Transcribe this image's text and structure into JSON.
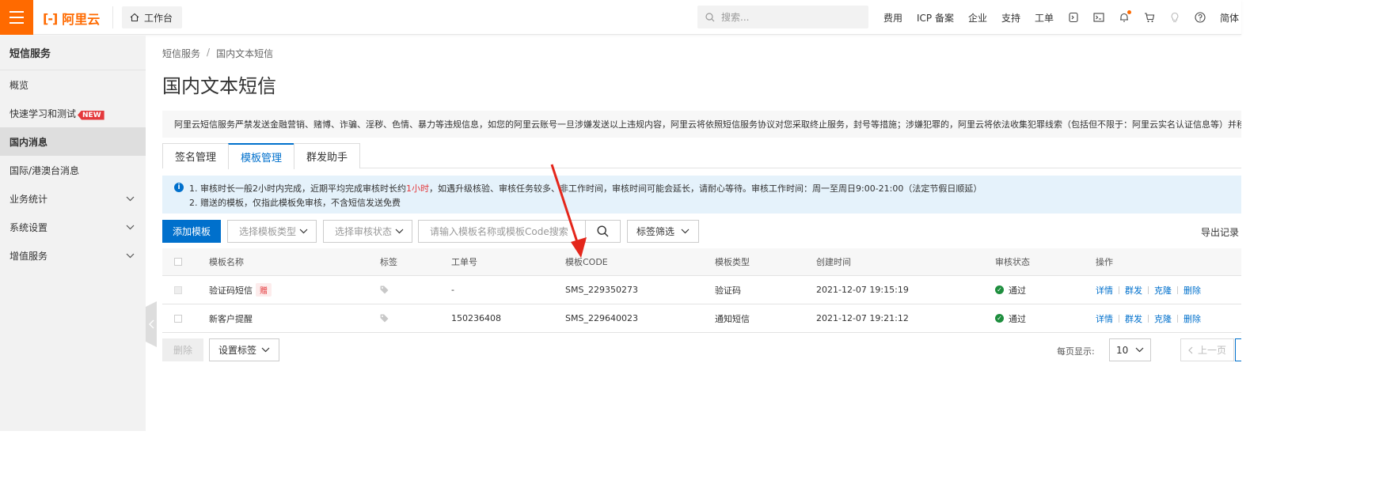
{
  "topbar": {
    "logo_text": "阿里云",
    "logo_mark": "[-]",
    "workbench": "工作台",
    "search_placeholder": "搜索...",
    "nav": [
      "费用",
      "ICP 备案",
      "企业",
      "支持",
      "工单"
    ],
    "language": "简体"
  },
  "sidebar": {
    "title": "短信服务",
    "items": [
      {
        "label": "概览"
      },
      {
        "label": "快速学习和测试",
        "badge": "NEW"
      },
      {
        "label": "国内消息",
        "active": true
      },
      {
        "label": "国际/港澳台消息"
      },
      {
        "label": "业务统计",
        "expandable": true
      },
      {
        "label": "系统设置",
        "expandable": true
      },
      {
        "label": "增值服务",
        "expandable": true
      }
    ]
  },
  "breadcrumb": [
    "短信服务",
    "国内文本短信"
  ],
  "breadcrumb_sep": "/",
  "page_title": "国内文本短信",
  "notice": "阿里云短信服务严禁发送金融营销、赌博、诈骗、淫秽、色情、暴力等违规信息，如您的阿里云账号一旦涉嫌发送以上违规内容，阿里云将依照短信服务协议对您采取终止服务，封号等措施；涉嫌犯罪的，阿里云将依法收集犯罪线索（包括但不限于：阿里云实名认证信息等）并移交公",
  "tabs": [
    {
      "label": "签名管理"
    },
    {
      "label": "模板管理",
      "active": true
    },
    {
      "label": "群发助手"
    }
  ],
  "info": {
    "icon": "i",
    "line1_prefix": "1. 审核时长一般2小时内完成，近期平均完成审核时长约",
    "line1_highlight": "1小时",
    "line1_suffix": "，如遇升级核验、审核任务较多、非工作时间，审核时间可能会延长，请耐心等待。审核工作时间：周一至周日9:00-21:00（法定节假日顺延）",
    "line2": "2. 赠送的模板，仅指此模板免审核，不含短信发送免费"
  },
  "toolbar": {
    "add_button": "添加模板",
    "type_select": "选择模板类型",
    "status_select": "选择审核状态",
    "search_placeholder": "请输入模板名称或模板Code搜索",
    "tag_filter": "标签筛选",
    "export": "导出记录"
  },
  "table": {
    "headers": [
      "模板名称",
      "标签",
      "工单号",
      "模板CODE",
      "模板类型",
      "创建时间",
      "审核状态",
      "操作"
    ],
    "rows": [
      {
        "name": "验证码短信",
        "gift": "赠",
        "ticket": "-",
        "code": "SMS_229350273",
        "type": "验证码",
        "created": "2021-12-07 19:15:19",
        "status": "通过"
      },
      {
        "name": "新客户提醒",
        "gift": "",
        "ticket": "150236408",
        "code": "SMS_229640023",
        "type": "通知短信",
        "created": "2021-12-07 19:21:12",
        "status": "通过"
      }
    ],
    "actions": [
      "详情",
      "群发",
      "克隆",
      "删除"
    ]
  },
  "footer": {
    "delete": "删除",
    "set_tag": "设置标签",
    "page_size_label": "每页显示:",
    "page_size": "10",
    "prev": "上一页"
  },
  "colors": {
    "brand": "#ff6a00",
    "primary": "#0070cc",
    "annotation_arrow": "#e4261b",
    "success": "#1e8e3e"
  }
}
